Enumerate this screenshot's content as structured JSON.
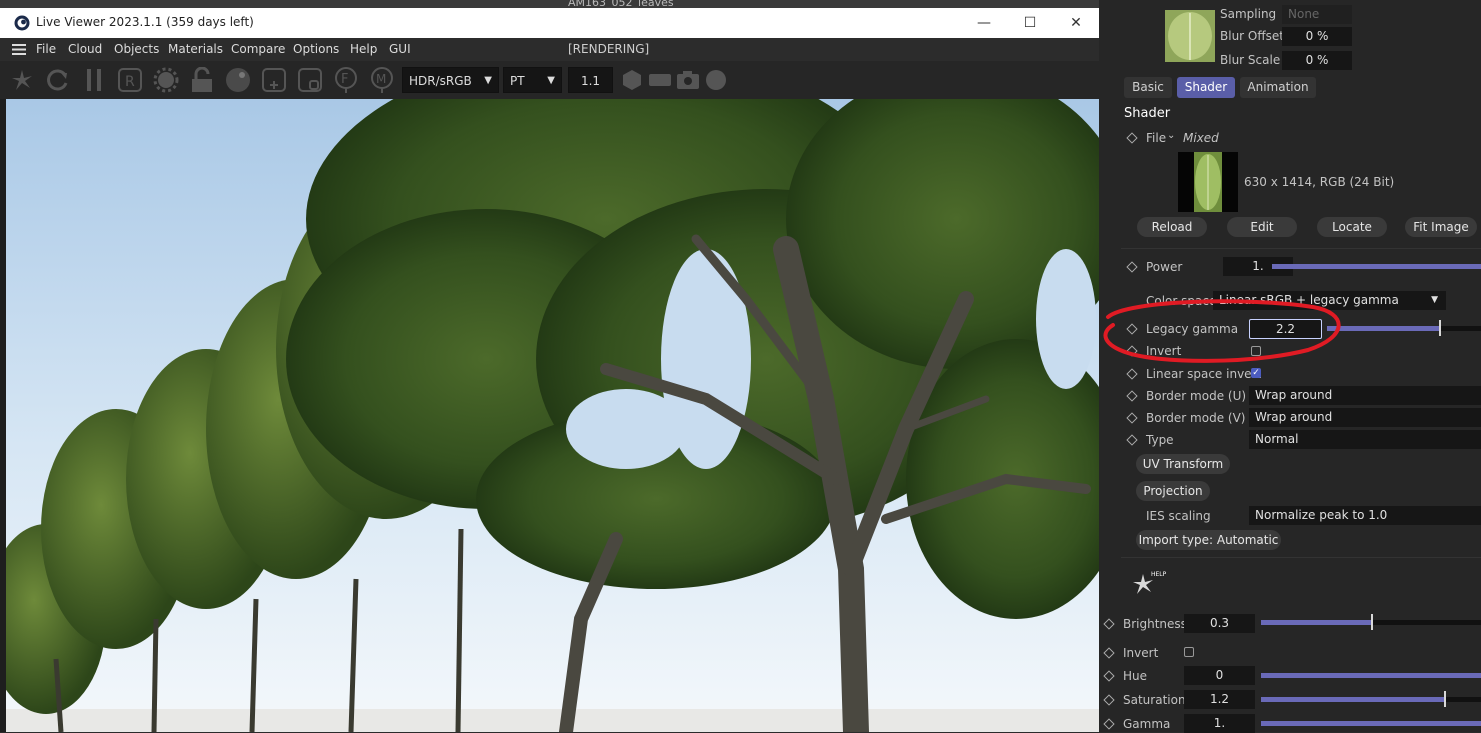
{
  "window": {
    "title": "Live Viewer 2023.1.1 (359 days left)",
    "minimize_label": "—",
    "maximize_label": "☐",
    "close_label": "✕"
  },
  "menu": {
    "items": [
      "File",
      "Cloud",
      "Objects",
      "Materials",
      "Compare",
      "Options",
      "Help",
      "GUI"
    ],
    "status": "[RENDERING]"
  },
  "toolbar": {
    "color_space": "HDR/sRGB",
    "kernel": "PT",
    "zoom": "1.1"
  },
  "scene": {
    "object_name": "AM163_052_leaves"
  },
  "panel": {
    "sampling_label": "Sampling",
    "sampling_value": "None",
    "blur_offset_label": "Blur Offset",
    "blur_offset_value": "0 %",
    "blur_scale_label": "Blur Scale",
    "blur_scale_value": "0 %",
    "tabs": [
      "Basic",
      "Shader",
      "Animation"
    ],
    "active_tab": "Shader",
    "section_title": "Shader",
    "file_label": "File",
    "file_value": "Mixed",
    "image_info": "630 x 1414, RGB (24 Bit)",
    "file_buttons": [
      "Reload",
      "Edit",
      "Locate",
      "Fit Image"
    ],
    "power_label": "Power",
    "power_value": "1.",
    "power_fill": 1.0,
    "color_space_label": "Color space",
    "color_space_value": "Linear sRGB + legacy gamma",
    "legacy_gamma_label": "Legacy gamma",
    "legacy_gamma_value": "2.2",
    "legacy_gamma_fill": 0.73,
    "invert_label": "Invert",
    "linear_invert_label": "Linear space invert",
    "border_u_label": "Border mode (U)",
    "border_u_value": "Wrap around",
    "border_v_label": "Border mode (V)",
    "border_v_value": "Wrap around",
    "type_label": "Type",
    "type_value": "Normal",
    "uv_transform_label": "UV Transform",
    "projection_label": "Projection",
    "ies_label": "IES scaling",
    "ies_value": "Normalize peak to 1.0",
    "import_type_label": "Import type: Automatic",
    "help_label": "HELP",
    "brightness_label": "Brightness",
    "brightness_value": "0.3",
    "brightness_fill": 0.5,
    "invert2_label": "Invert",
    "hue_label": "Hue",
    "hue_value": "0",
    "hue_fill": 1.0,
    "saturation_label": "Saturation",
    "saturation_value": "1.2",
    "saturation_fill": 0.83,
    "gamma_label": "Gamma",
    "gamma_value": "1.",
    "gamma_fill": 1.0
  },
  "colors": {
    "accent": "#5a5ea8",
    "slider": "#6a6ab8",
    "annotation": "#e01b24"
  }
}
